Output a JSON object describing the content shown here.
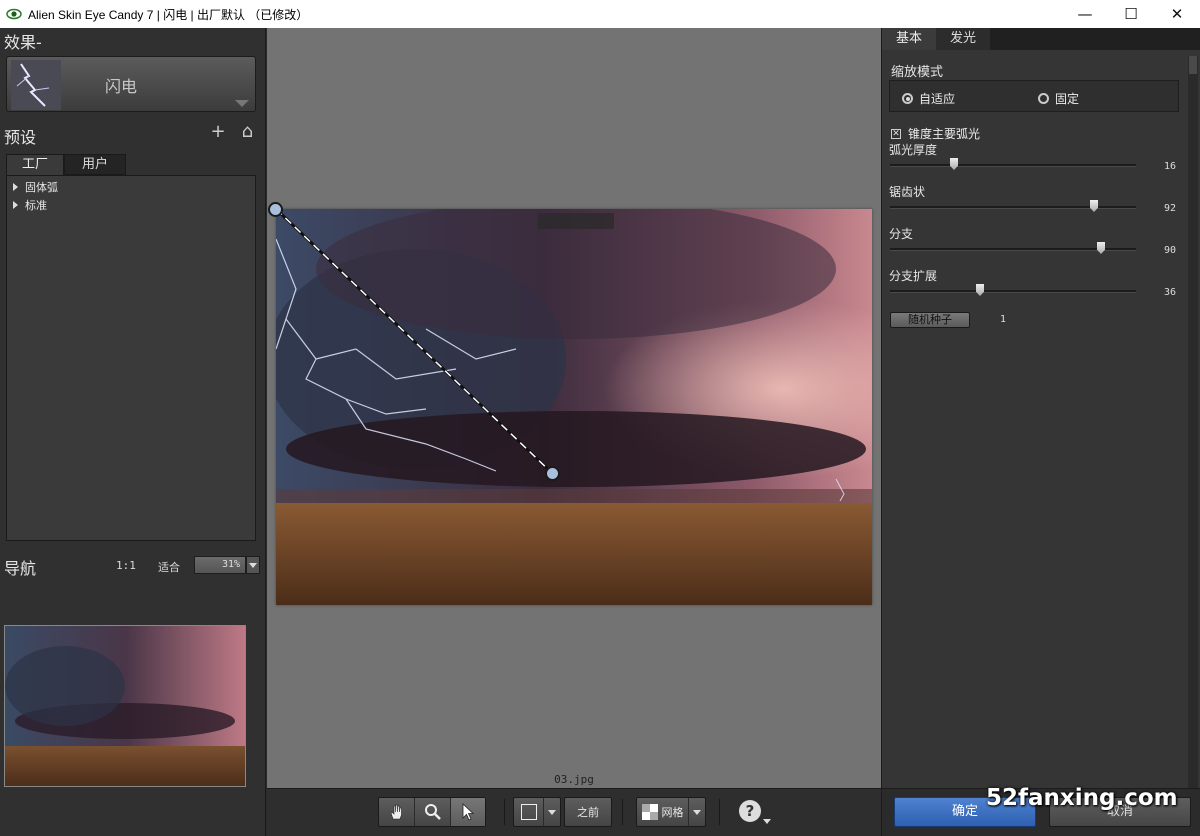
{
  "window": {
    "title": "Alien Skin Eye Candy 7 | 闪电 | 出厂默认 （已修改）",
    "minimize": "—",
    "maximize": "☐",
    "close": "✕"
  },
  "left": {
    "effects_header": "效果-",
    "effect_name": "闪电",
    "presets_header": "预设",
    "add_icon": "+",
    "home_icon": "⌂",
    "tabs": [
      "工厂",
      "用户"
    ],
    "tree": [
      "固体弧",
      "标准"
    ],
    "nav_header": "导航",
    "zoom_1to1": "1:1",
    "fit_label": "适合",
    "zoom_value": "31%"
  },
  "canvas": {
    "filename": "03.jpg",
    "before_label": "之前",
    "grid_label": "网格",
    "help_icon": "?"
  },
  "right": {
    "tabs": [
      "基本",
      "发光"
    ],
    "scale_mode_label": "缩放模式",
    "scale_options": [
      {
        "label": "自适应",
        "selected": true
      },
      {
        "label": "固定",
        "selected": false
      }
    ],
    "taper_label": "锥度主要弧光",
    "taper_checked": true,
    "sliders": [
      {
        "label": "弧光厚度",
        "value": "16",
        "fraction": 0.25
      },
      {
        "label": "锯齿状",
        "value": "92",
        "fraction": 0.84
      },
      {
        "label": "分支",
        "value": "90",
        "fraction": 0.87
      },
      {
        "label": "分支扩展",
        "value": "36",
        "fraction": 0.36
      }
    ],
    "seed_button": "随机种子",
    "seed_value": "1",
    "ok_button": "确定",
    "cancel_button": "取消"
  },
  "watermark": "52fanxing.com",
  "colors": {
    "panel": "#303030",
    "canvas_bg": "#737373",
    "ok_blue": "#3b6fc2"
  }
}
